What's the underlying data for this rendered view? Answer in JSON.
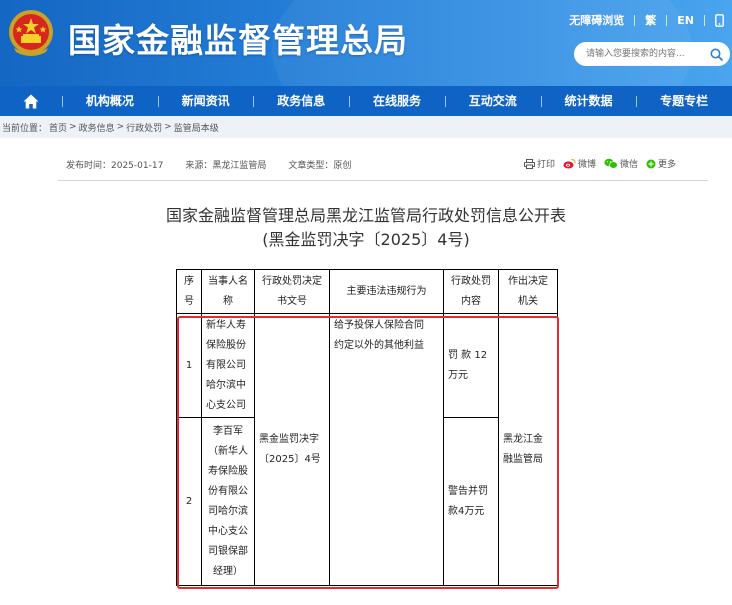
{
  "header": {
    "site_title": "国家金融监督管理总局",
    "links": [
      "无障碍浏览",
      "繁",
      "EN"
    ],
    "search_placeholder": "请输入您要搜索的内容..."
  },
  "nav": {
    "items": [
      "机构概况",
      "新闻资讯",
      "政务信息",
      "在线服务",
      "互动交流",
      "统计数据",
      "专题专栏"
    ]
  },
  "breadcrumb": {
    "label": "当前位置：",
    "items": [
      "首页",
      "政务信息",
      "行政处罚",
      "监管局本级"
    ],
    "separator": ">"
  },
  "meta": {
    "publish_time": "发布时间：2025-01-17",
    "source": "来源：黑龙江监管局",
    "doc_type": "文章类型：原创",
    "share": [
      "打印",
      "微博",
      "微信",
      "更多"
    ]
  },
  "article": {
    "title_line1": "国家金融监督管理总局黑龙江监管局行政处罚信息公开表",
    "title_line2": "(黑金监罚决字〔2025〕4号)"
  },
  "table": {
    "headers": {
      "seq": [
        "序",
        "号"
      ],
      "party": [
        "当事人名",
        "称"
      ],
      "doc_no": [
        "行政处罚决定",
        "书文号"
      ],
      "violation": [
        "主要违法违规行为"
      ],
      "penalty": [
        "行政处罚",
        "内容"
      ],
      "authority": [
        "作出决定",
        "机关"
      ]
    },
    "rows": [
      {
        "seq": "1",
        "party": [
          "新华人寿",
          "保险股份",
          "有限公司",
          "哈尔滨中",
          "心支公司"
        ],
        "penalty": [
          "罚 款 12",
          "万元"
        ]
      },
      {
        "seq": "2",
        "party": [
          "李百军",
          "（新华人",
          "寿保险股",
          "份有限公",
          "司哈尔滨",
          "中心支公",
          "司银保部",
          "经理）"
        ],
        "penalty": [
          "警告并罚",
          "款4万元"
        ]
      }
    ],
    "doc_no": [
      "黑金监罚决字",
      "〔2025〕4号"
    ],
    "violation": [
      "给予投保人保险合同",
      "约定以外的其他利益"
    ],
    "authority": [
      "黑龙江金",
      "融监管局"
    ]
  }
}
